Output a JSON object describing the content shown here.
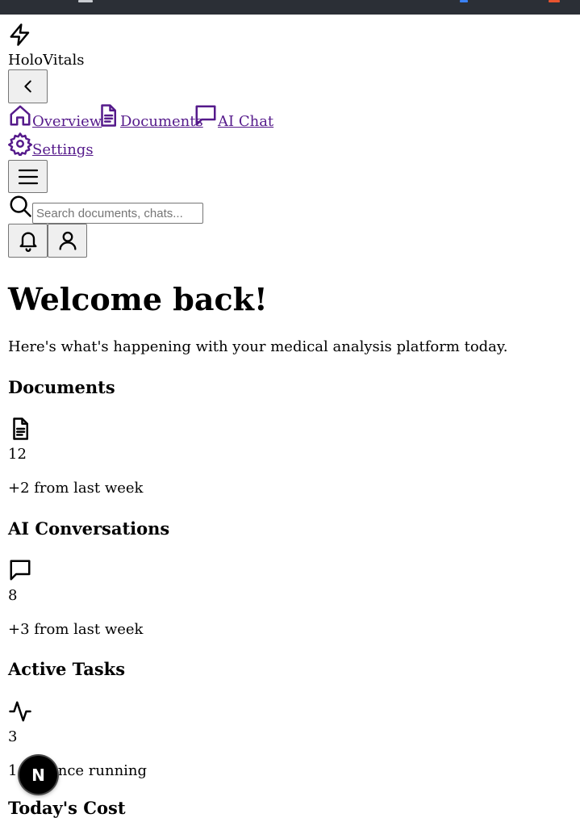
{
  "app": {
    "name": "HoloVitals"
  },
  "nav": {
    "items": [
      {
        "label": "Overview",
        "icon": "home-icon"
      },
      {
        "label": "Documents",
        "icon": "document-icon"
      },
      {
        "label": "AI Chat",
        "icon": "chat-icon"
      },
      {
        "label": "Settings",
        "icon": "gear-icon"
      }
    ]
  },
  "search": {
    "placeholder": "Search documents, chats..."
  },
  "main": {
    "title": "Welcome back!",
    "subtitle": "Here's what's happening with your medical analysis platform today.",
    "cards": [
      {
        "title": "Documents",
        "icon": "document-icon",
        "value": "12",
        "change": "+2 from last week"
      },
      {
        "title": "AI Conversations",
        "icon": "chat-icon",
        "value": "8",
        "change": "+3 from last week"
      },
      {
        "title": "Active Tasks",
        "icon": "activity-icon",
        "value": "3",
        "change": "1 instance running"
      },
      {
        "title": "Today's Cost",
        "icon": "dollar-icon"
      }
    ]
  },
  "overlay": {
    "badge_letter": "N"
  },
  "colors": {
    "topbar": "#2b2f36",
    "link": "#551a8b",
    "button_bg": "#efefef",
    "button_border": "#767676"
  }
}
